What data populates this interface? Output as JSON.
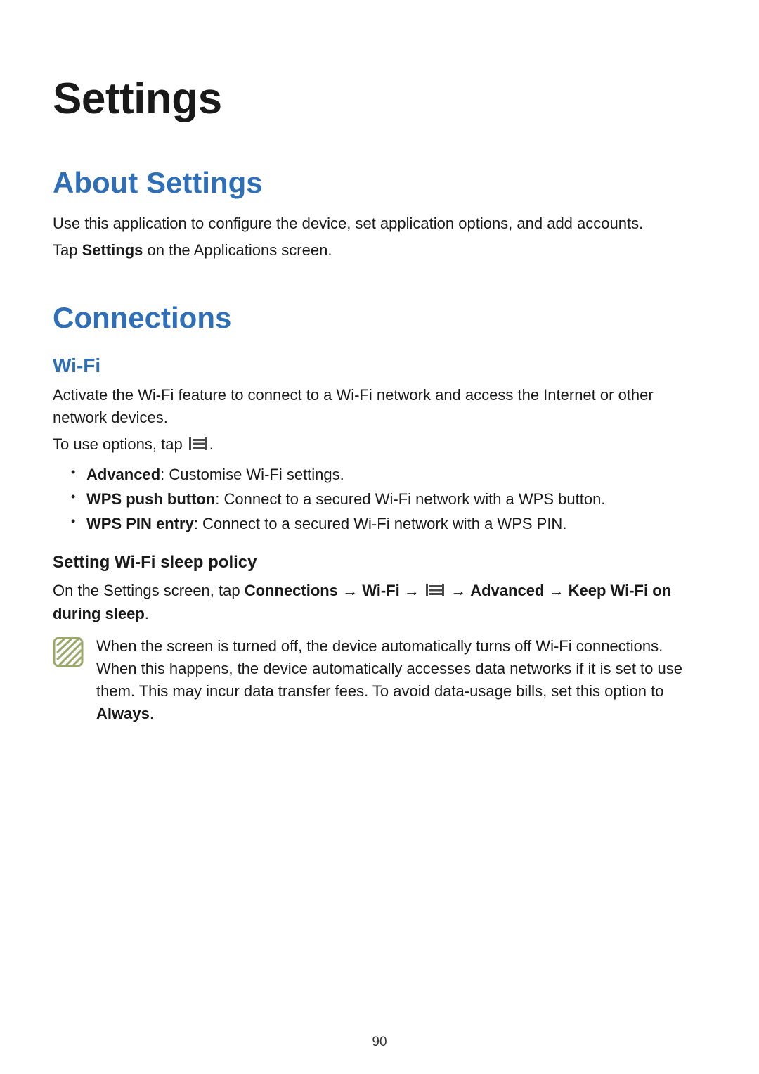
{
  "page": {
    "number": "90",
    "chapter_title": "Settings"
  },
  "about": {
    "heading": "About Settings",
    "p1": "Use this application to configure the device, set application options, and add accounts.",
    "p2_prefix": "Tap ",
    "p2_bold": "Settings",
    "p2_suffix": " on the Applications screen."
  },
  "connections": {
    "heading": "Connections",
    "wifi": {
      "heading": "Wi-Fi",
      "p1": "Activate the Wi-Fi feature to connect to a Wi-Fi network and access the Internet or other network devices.",
      "p2_prefix": "To use options, tap ",
      "p2_suffix": ".",
      "bullets": {
        "b1_bold": "Advanced",
        "b1_rest": ": Customise Wi-Fi settings.",
        "b2_bold": "WPS push button",
        "b2_rest": ": Connect to a secured Wi-Fi network with a WPS button.",
        "b3_bold": "WPS PIN entry",
        "b3_rest": ": Connect to a secured Wi-Fi network with a WPS PIN."
      },
      "sleep": {
        "heading": "Setting Wi-Fi sleep policy",
        "p_prefix": "On the Settings screen, tap ",
        "p_b1": "Connections",
        "arrow": " → ",
        "p_b2": "Wi-Fi",
        "p_b3": "Advanced",
        "p_b4": "Keep Wi-Fi on during sleep",
        "p_period": ".",
        "note_main": "When the screen is turned off, the device automatically turns off Wi-Fi connections. When this happens, the device automatically accesses data networks if it is set to use them. This may incur data transfer fees. To avoid data-usage bills, set this option to ",
        "note_bold": "Always",
        "note_period": "."
      }
    }
  }
}
